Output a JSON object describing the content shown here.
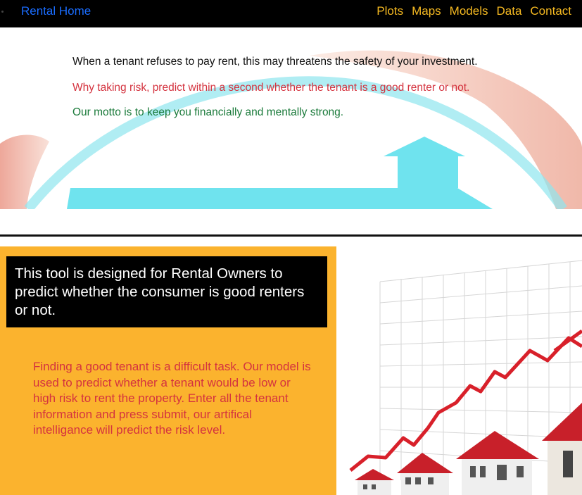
{
  "nav": {
    "brand": "Rental Home",
    "links": [
      "Plots",
      "Maps",
      "Models",
      "Data",
      "Contact"
    ]
  },
  "hero": {
    "line1": "When a tenant refuses to pay rent, this may threatens the safety of your investment.",
    "line2": "Why taking risk, predict within a second whether the tenant is a good renter or not.",
    "line3": "Our motto is to keep you financially and mentally strong."
  },
  "panel": {
    "heading": "This tool is designed for Rental Owners to predict whether the consumer is good renters or not.",
    "description": "Finding a good tenant is a difficult task. Our model is used to predict whether a tenant would be low or high risk to rent the property. Enter all the tenant information and press submit, our artifical intelligance will predict the risk level."
  },
  "colors": {
    "nav_bg": "#000000",
    "brand": "#1a6dff",
    "nav_link": "#f5b921",
    "panel_bg": "#fbb32e",
    "red_text": "#d4333f",
    "green_text": "#1a7a3a"
  }
}
